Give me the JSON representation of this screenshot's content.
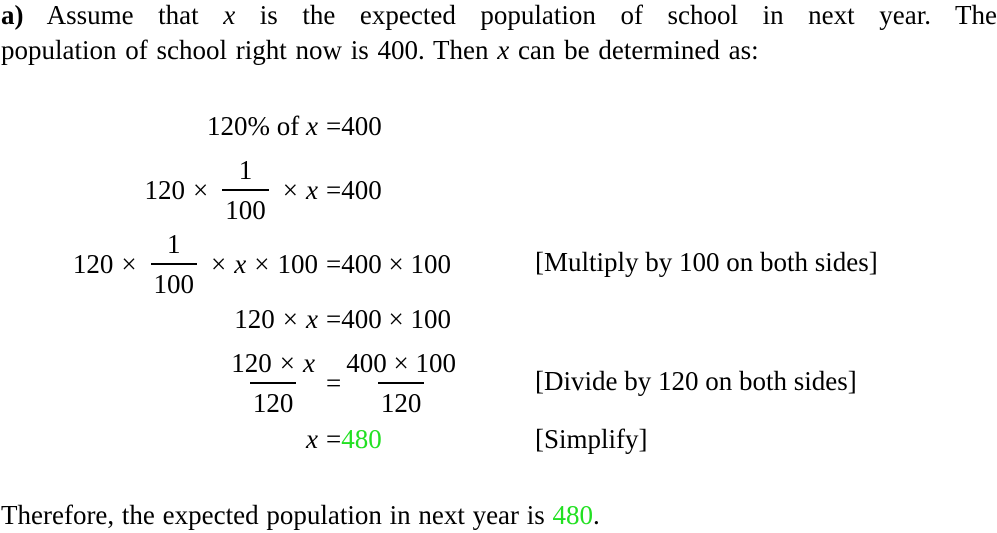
{
  "intro": {
    "label": "a)",
    "line1_before_var": "Assume that",
    "variable": "x",
    "line1_after_var": "is the expected population of school in next year.  The",
    "line2_before_var": "population of school right now is 400.  Then",
    "line2_after_var": "can be determined as:"
  },
  "equations": [
    {
      "lhs": {
        "prefix": "120% of",
        "var": "x"
      },
      "eq": "=",
      "rhs": "400",
      "note": ""
    },
    {
      "lhs": {
        "a": "120",
        "times1": "×",
        "frac_num": "1",
        "frac_den": "100",
        "times2": "×",
        "var": "x"
      },
      "eq": "=",
      "rhs": "400",
      "note": ""
    },
    {
      "lhs": {
        "a": "120",
        "times1": "×",
        "frac_num": "1",
        "frac_den": "100",
        "times2": "×",
        "var": "x",
        "times3": "×",
        "b": "100"
      },
      "eq": "=",
      "rhs": "400 × 100",
      "note": "[Multiply by 100 on both sides]"
    },
    {
      "lhs": {
        "a": "120",
        "times1": "×",
        "var": "x"
      },
      "eq": "=",
      "rhs": "400 × 100",
      "note": ""
    },
    {
      "lhs": {
        "num_a": "120",
        "num_times": "×",
        "num_var": "x",
        "den": "120"
      },
      "eq": "=",
      "rhs": {
        "num": "400 × 100",
        "den": "120"
      },
      "note": "[Divide by 120 on both sides]"
    },
    {
      "lhs": {
        "var": "x"
      },
      "eq": "=",
      "rhs": "480",
      "note": "[Simplify]"
    }
  ],
  "conclusion": {
    "text": "Therefore, the expected population in next year is",
    "answer": "480",
    "end": "."
  },
  "colors": {
    "answer": "#22e022",
    "text": "#000000"
  }
}
